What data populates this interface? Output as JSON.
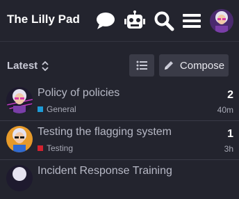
{
  "header": {
    "site_title": "The Lilly Pad",
    "icons": [
      "chat-icon",
      "robot-icon",
      "search-icon",
      "hamburger-menu-icon",
      "user-avatar"
    ]
  },
  "controls": {
    "filter_label": "Latest",
    "compose_label": "Compose"
  },
  "topics": [
    {
      "title": "Policy of policies",
      "category": "General",
      "category_color": "#1d9bd7",
      "replies": "2",
      "age": "40m"
    },
    {
      "title": "Testing the flagging system",
      "category": "Testing",
      "category_color": "#d3222f",
      "replies": "1",
      "age": "3h"
    },
    {
      "title": "Incident Response Training",
      "category": "",
      "category_color": "#1d9bd7",
      "replies": "",
      "age": ""
    }
  ],
  "colors": {
    "background": "#23242e",
    "button": "#3a3b47",
    "divider": "#3a3b47"
  }
}
